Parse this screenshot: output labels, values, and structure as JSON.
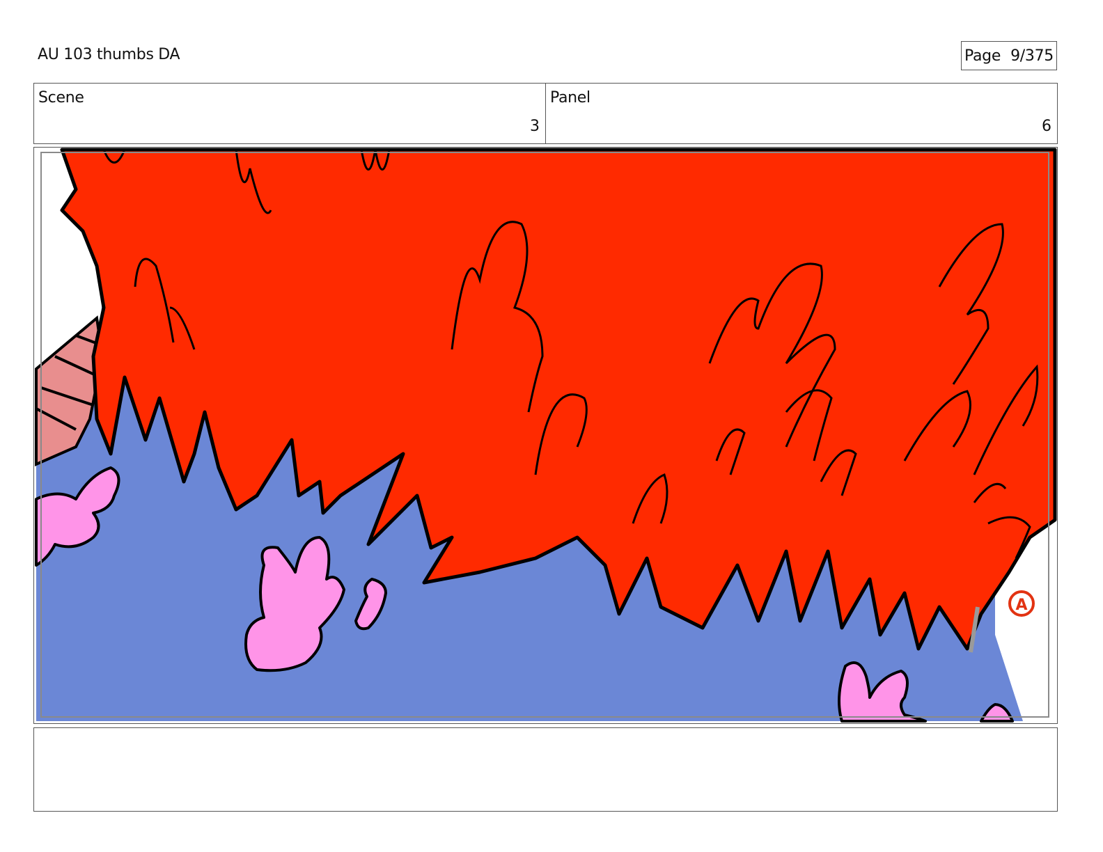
{
  "header": {
    "title": "AU 103 thumbs DA",
    "page_label": "Page",
    "page_value": "9/375"
  },
  "fields": {
    "scene_label": "Scene",
    "scene_value": "3",
    "panel_label": "Panel",
    "panel_value": "6"
  },
  "panel_image": {
    "colors": {
      "sky": "#ffffff",
      "ground": "#6b87d6",
      "fire": "#ff2a00",
      "blossom": "#ff94e8",
      "roof": "#e88e8e",
      "mark": "#e23312",
      "ink": "#000000"
    },
    "corner_mark": "A"
  },
  "notes": {
    "text": ""
  }
}
